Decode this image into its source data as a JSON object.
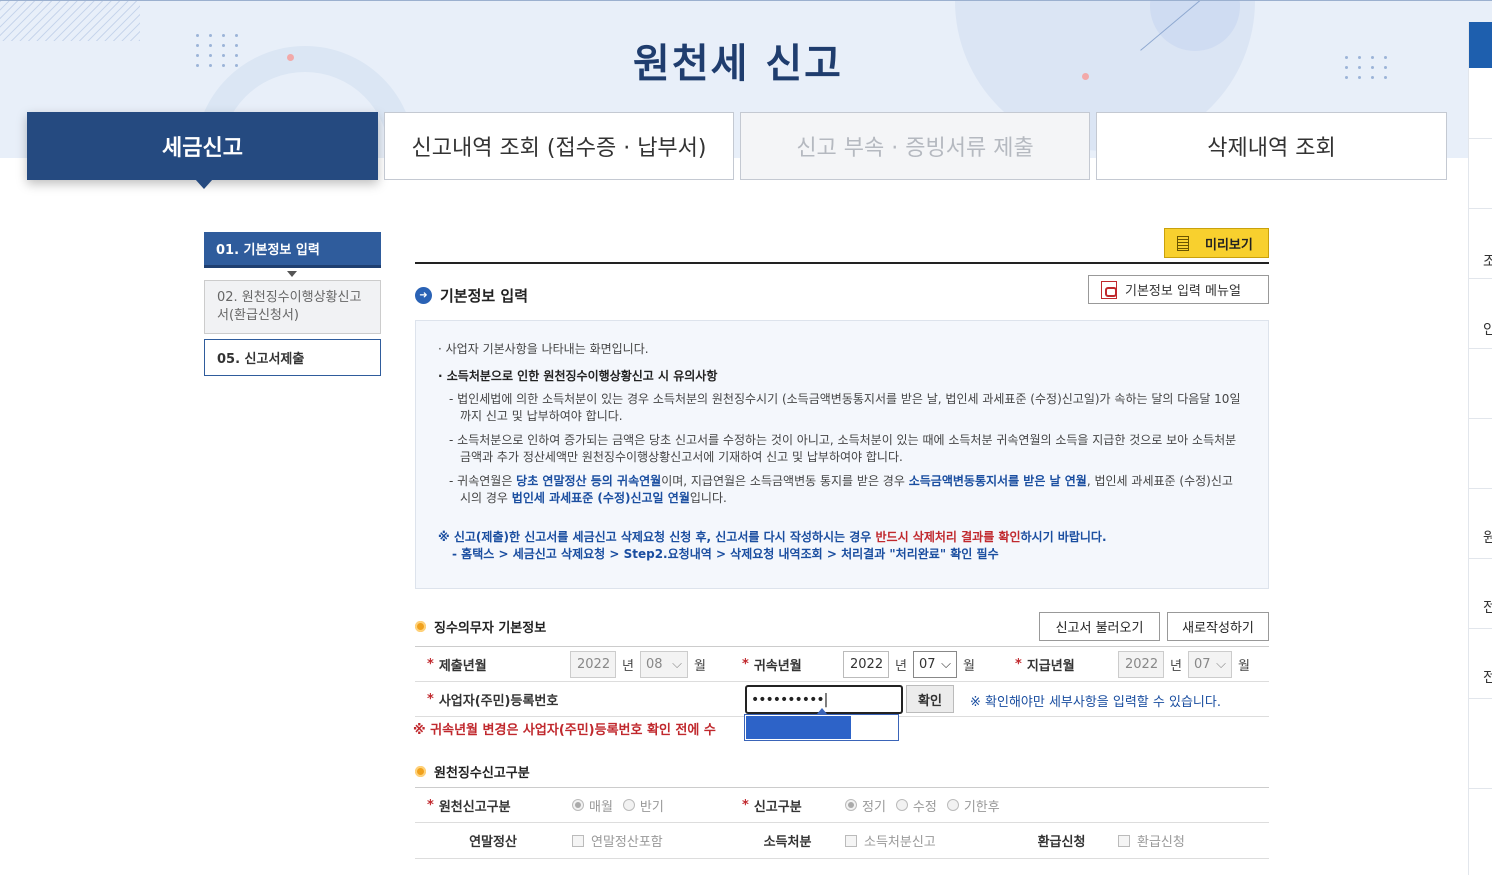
{
  "page": {
    "title": "원천세 신고"
  },
  "tabs": [
    {
      "label": "세금신고",
      "state": "active"
    },
    {
      "label": "신고내역 조회 (접수증 · 납부서)",
      "state": "normal"
    },
    {
      "label": "신고 부속 · 증빙서류 제출",
      "state": "disabled"
    },
    {
      "label": "삭제내역 조회",
      "state": "normal"
    }
  ],
  "steps": [
    {
      "label": "01. 기본정보 입력",
      "state": "active"
    },
    {
      "label": "02. 원천징수이행상황신고서(환급신청서)",
      "state": "normal"
    },
    {
      "label": "05. 신고서제출",
      "state": "outlined"
    }
  ],
  "toolbar": {
    "preview_label": "미리보기",
    "manual_label": "기본정보 입력 메뉴얼"
  },
  "section_basic": {
    "title": "기본정보 입력"
  },
  "notice": {
    "line1": "사업자 기본사항을 나타내는 화면입니다.",
    "line2": "소득처분으로 인한 원천징수이행상황신고 시 유의사항",
    "dash1": "법인세법에 의한 소득처분이 있는 경우 소득처분의 원천징수시기 (소득금액변동통지서를 받은 날, 법인세 과세표준 (수정)신고일)가 속하는 달의 다음달 10일까지 신고 및 납부하여야 합니다.",
    "dash2": "소득처분으로 인하여 증가되는 금액은 당초 신고서를 수정하는 것이 아니고, 소득처분이 있는 때에 소득처분 귀속연월의 소득을 지급한 것으로 보아 소득처분금액과 추가 정산세액만 원천징수이행상황신고서에 기재하여 신고 및 납부하여야 합니다.",
    "dash3_a": "귀속연월은 ",
    "dash3_b": "당초 연말정산 등의 귀속연월",
    "dash3_c": "이며, 지급연월은 소득금액변동 통지를 받은 경우 ",
    "dash3_d": "소득금액변동통지서를 받은 날 연월",
    "dash3_e": ", 법인세 과세표준 (수정)신고 시의 경우 ",
    "dash3_f": "법인세 과세표준 (수정)신고일 연월",
    "dash3_g": "입니다.",
    "warn_a": "※ 신고(제출)한 신고서를 세금신고 삭제요청 신청 후, 신고서를 다시 작성하시는 경우 ",
    "warn_b": "반드시 삭제처리 결과를 확인",
    "warn_c": "하시기 바랍니다.",
    "warn2": "- 홈택스 > 세금신고 삭제요청 > Step2.요청내역 > 삭제요청 내역조회 > 처리결과 \"처리완료\" 확인 필수"
  },
  "withholder": {
    "title": "징수의무자 기본정보",
    "load_label": "신고서 불러오기",
    "new_label": "새로작성하기",
    "submit_ym_label": "제출년월",
    "submit_year": "2022",
    "submit_month": "08",
    "attr_ym_label": "귀속년월",
    "attr_year": "2022",
    "attr_month": "07",
    "pay_ym_label": "지급년월",
    "pay_year": "2022",
    "pay_month": "07",
    "unit_year": "년",
    "unit_month": "월",
    "biz_no_label": "사업자(주민)등록번호",
    "biz_no_value": "••••••••••|",
    "confirm_label": "확인",
    "hint": "※ 확인해야만 세부사항을 입력할 수 있습니다.",
    "warning": "※ 귀속년월 변경은 사업자(주민)등록번호 확인 전에 수"
  },
  "report_type": {
    "title": "원천징수신고구분",
    "type_label": "원천신고구분",
    "type_opts": [
      "매월",
      "반기"
    ],
    "kind_label": "신고구분",
    "kind_opts": [
      "정기",
      "수정",
      "기한후"
    ],
    "yearend_label": "연말정산",
    "yearend_opt": "연말정산포함",
    "disposal_label": "소득처분",
    "disposal_opt": "소득처분신고",
    "refund_label": "환급신청",
    "refund_opt": "환급신청"
  },
  "side_strip": {
    "chars": [
      "조",
      "인",
      "원",
      "전",
      "전"
    ]
  }
}
